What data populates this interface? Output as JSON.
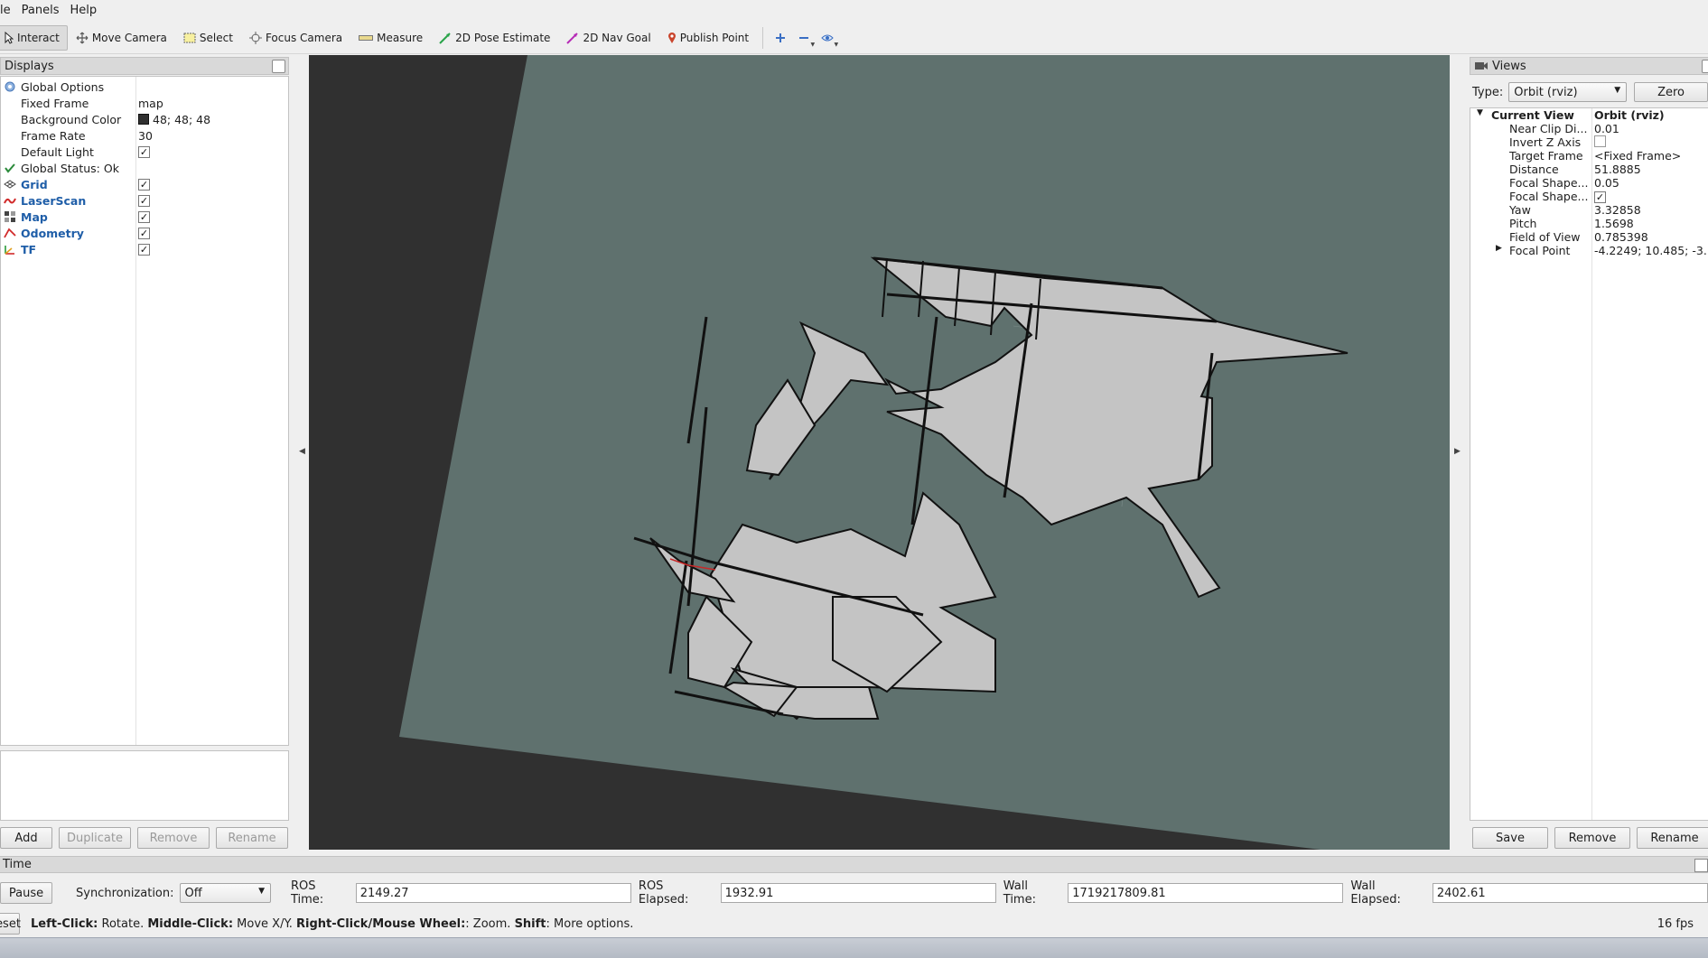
{
  "menu": {
    "items": [
      "le",
      "Panels",
      "Help"
    ]
  },
  "toolbar": {
    "tools": [
      {
        "label": "Interact",
        "icon": "interact-icon"
      },
      {
        "label": "Move Camera",
        "icon": "move-camera-icon"
      },
      {
        "label": "Select",
        "icon": "select-icon"
      },
      {
        "label": "Focus Camera",
        "icon": "focus-camera-icon"
      },
      {
        "label": "Measure",
        "icon": "measure-icon"
      },
      {
        "label": "2D Pose Estimate",
        "icon": "pose-estimate-icon"
      },
      {
        "label": "2D Nav Goal",
        "icon": "nav-goal-icon"
      },
      {
        "label": "Publish Point",
        "icon": "publish-point-icon"
      }
    ],
    "extra_icons": [
      "plus-icon",
      "minus-icon",
      "eye-icon"
    ]
  },
  "displays": {
    "title": "Displays",
    "global_options": "Global Options",
    "fixed_frame": {
      "label": "Fixed Frame",
      "value": "map"
    },
    "background_color": {
      "label": "Background Color",
      "value": "48; 48; 48",
      "color": "#303030"
    },
    "frame_rate": {
      "label": "Frame Rate",
      "value": "30"
    },
    "default_light": {
      "label": "Default Light",
      "checked": true
    },
    "global_status": "Global Status: Ok",
    "items": [
      {
        "label": "Grid",
        "checked": true,
        "icon": "grid-icon"
      },
      {
        "label": "LaserScan",
        "checked": true,
        "icon": "laserscan-icon"
      },
      {
        "label": "Map",
        "checked": true,
        "icon": "map-icon"
      },
      {
        "label": "Odometry",
        "checked": true,
        "icon": "odometry-icon"
      },
      {
        "label": "TF",
        "checked": true,
        "icon": "tf-icon"
      }
    ],
    "buttons": {
      "add": "Add",
      "duplicate": "Duplicate",
      "remove": "Remove",
      "rename": "Rename"
    }
  },
  "views": {
    "title": "Views",
    "type_label": "Type:",
    "type_value": "Orbit (rviz)",
    "zero": "Zero",
    "current_view": {
      "label": "Current View",
      "value": "Orbit (rviz)"
    },
    "properties": [
      {
        "label": "Near Clip Di...",
        "value": "0.01"
      },
      {
        "label": "Invert Z Axis",
        "value": "",
        "checkbox": false
      },
      {
        "label": "Target Frame",
        "value": "<Fixed Frame>"
      },
      {
        "label": "Distance",
        "value": "51.8885"
      },
      {
        "label": "Focal Shape...",
        "value": "0.05"
      },
      {
        "label": "Focal Shape...",
        "value": "",
        "checkbox": true
      },
      {
        "label": "Yaw",
        "value": "3.32858"
      },
      {
        "label": "Pitch",
        "value": "1.5698"
      },
      {
        "label": "Field of View",
        "value": "0.785398"
      },
      {
        "label": "Focal Point",
        "value": "-4.2249; 10.485; -3..."
      }
    ],
    "buttons": {
      "save": "Save",
      "remove": "Remove",
      "rename": "Rename"
    }
  },
  "time": {
    "title": "Time",
    "pause": "Pause",
    "sync_label": "Synchronization:",
    "sync_value": "Off",
    "ros_time_label": "ROS Time:",
    "ros_time": "2149.27",
    "ros_elapsed_label": "ROS Elapsed:",
    "ros_elapsed": "1932.91",
    "wall_time_label": "Wall Time:",
    "wall_time": "1719217809.81",
    "wall_elapsed_label": "Wall Elapsed:",
    "wall_elapsed": "2402.61"
  },
  "status": {
    "reset": "eset",
    "left_click": "Left-Click:",
    "left_click_desc": " Rotate. ",
    "middle_click": "Middle-Click:",
    "middle_click_desc": " Move X/Y. ",
    "right_click": "Right-Click/Mouse Wheel:",
    "right_click_desc": ": Zoom. ",
    "shift": "Shift",
    "shift_desc": ": More options.",
    "fps": "16 fps"
  },
  "colors": {
    "viewport_bg": "#303030",
    "ground_plane": "#5f716e",
    "map_free": "#c4c4c4",
    "map_wall": "#111111",
    "link": "#1f5ea8"
  }
}
